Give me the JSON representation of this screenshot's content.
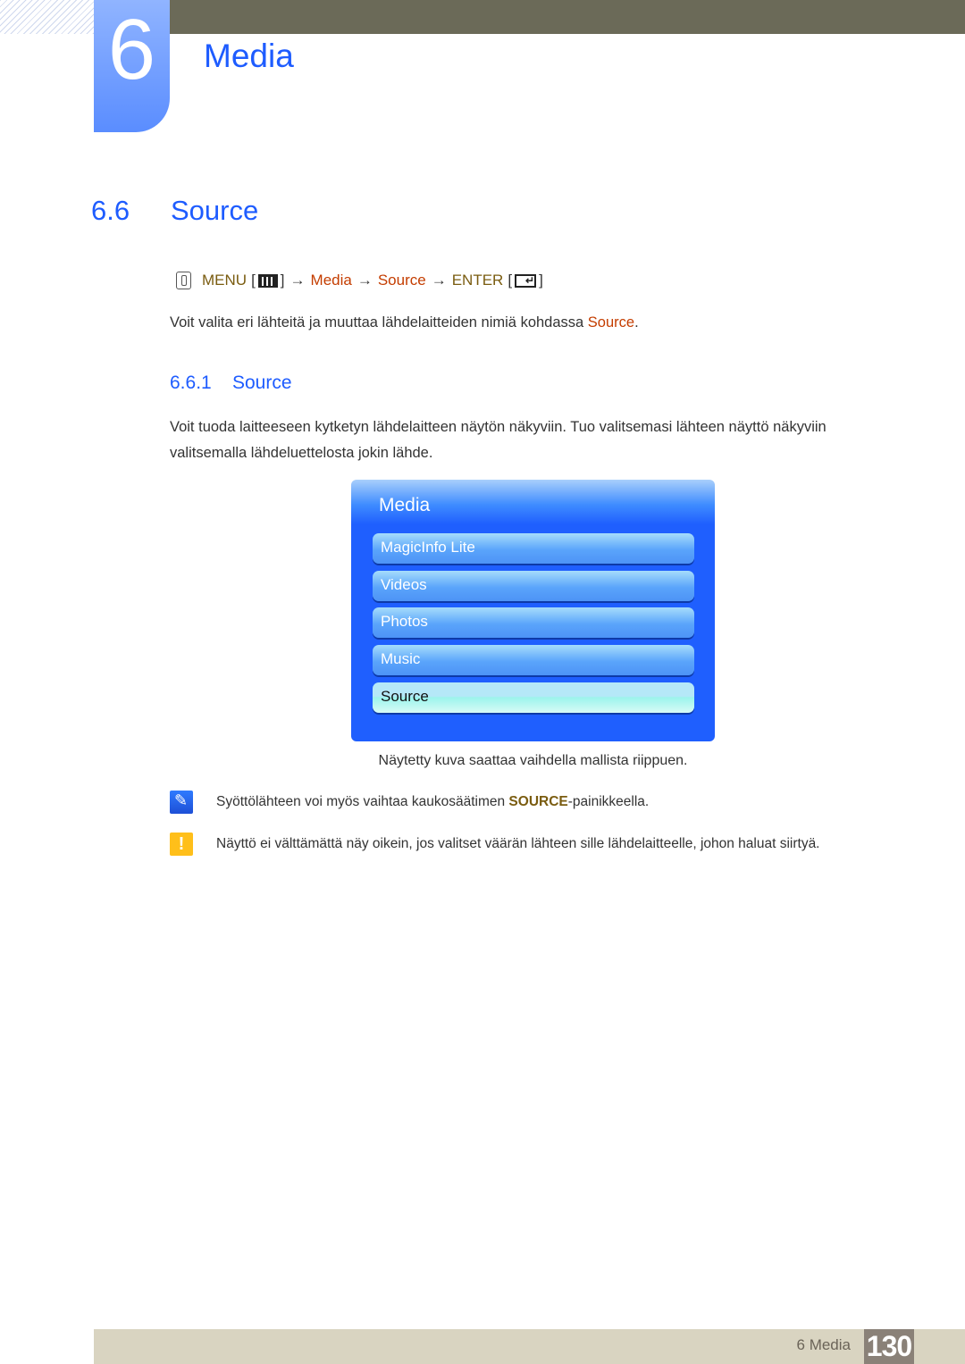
{
  "chapter": {
    "number": "6",
    "title": "Media"
  },
  "section": {
    "number": "6.6",
    "title": "Source"
  },
  "menu_path": {
    "menu_label": "MENU",
    "arrow": "→",
    "media_label": "Media",
    "source_label": "Source",
    "enter_label": "ENTER",
    "bracket_open": "[",
    "bracket_close": "]",
    "icons": [
      "hand-remote-icon",
      "menu-button-icon",
      "enter-button-icon"
    ]
  },
  "intro": {
    "text": "Voit valita eri lähteitä ja muuttaa lähdelaitteiden nimiä kohdassa ",
    "highlight": "Source",
    "end": "."
  },
  "subsection": {
    "number": "6.6.1",
    "title": "Source"
  },
  "description": {
    "line1": "Voit tuoda laitteeseen kytketyn lähdelaitteen näytön näkyviin. Tuo valitsemasi lähteen näyttö näkyviin",
    "line2": "valitsemalla lähdeluettelosta jokin lähde."
  },
  "osd_menu": {
    "title": "Media",
    "items": [
      {
        "label": "MagicInfo Lite",
        "selected": false
      },
      {
        "label": "Videos",
        "selected": false
      },
      {
        "label": "Photos",
        "selected": false
      },
      {
        "label": "Music",
        "selected": false
      },
      {
        "label": "Source",
        "selected": true
      }
    ]
  },
  "caption": "Näytetty kuva saattaa vaihdella mallista riippuen.",
  "notes": [
    {
      "icon": "note-pen-icon",
      "text_before": "Syöttölähteen voi myös vaihtaa kaukosäätimen ",
      "highlight": "SOURCE",
      "text_after": "-painikkeella."
    },
    {
      "icon": "warning-icon",
      "text": "Näyttö ei välttämättä näy oikein, jos valitset väärän lähteen sille lähdelaitteelle, johon haluat siirtyä."
    }
  ],
  "footer": {
    "chapter_label": "6 Media",
    "page_number": "130"
  },
  "colors": {
    "heading_blue": "#1e5cff",
    "highlight_red": "#c43d00",
    "olive": "#7a5c10",
    "top_bar": "#6b6a58",
    "footer_bg": "#d9d4c1",
    "page_badge": "#8a8178"
  }
}
